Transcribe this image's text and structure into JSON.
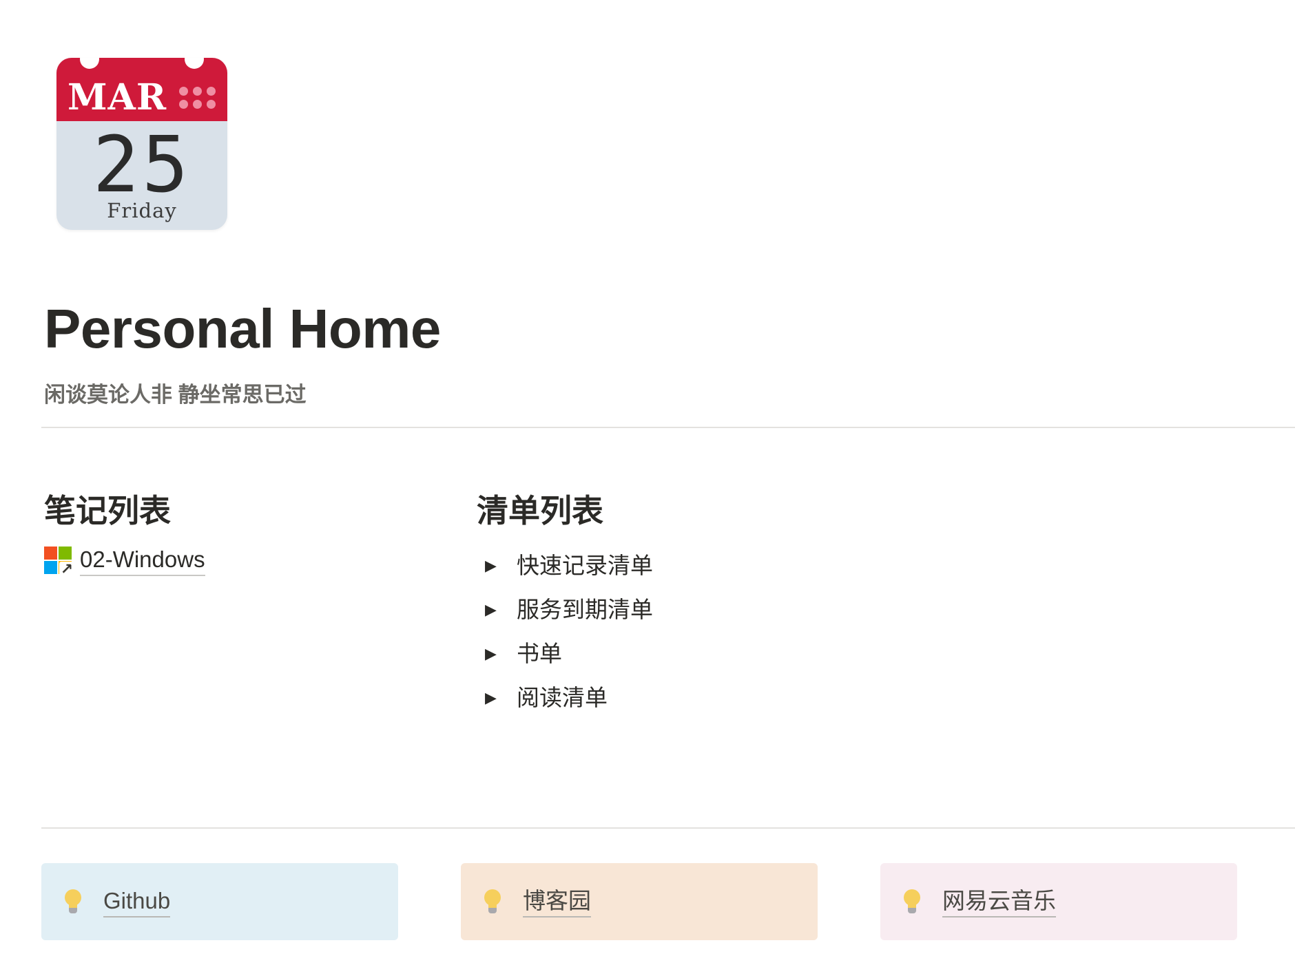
{
  "page_icon": {
    "icon": "calendar-icon",
    "month": "MAR",
    "day": "25",
    "weekday": "Friday",
    "colors": {
      "header": "#cf1a3a",
      "body": "#d9e1e9",
      "dots": "#ef8fa3"
    }
  },
  "page": {
    "title": "Personal Home",
    "subtitle": "闲谈莫论人非 静坐常思已过"
  },
  "notes_section": {
    "heading": "笔记列表",
    "links": [
      {
        "label": "02-Windows",
        "icon": "windows-logo-link-icon"
      }
    ]
  },
  "lists_section": {
    "heading": "清单列表",
    "toggles": [
      {
        "label": "快速记录清单",
        "icon": "toggle-arrow-icon"
      },
      {
        "label": "服务到期清单",
        "icon": "toggle-arrow-icon"
      },
      {
        "label": "书单",
        "icon": "toggle-arrow-icon"
      },
      {
        "label": "阅读清单",
        "icon": "toggle-arrow-icon"
      }
    ],
    "arrow_glyph": "▶"
  },
  "callouts": [
    {
      "label": "Github",
      "icon": "lightbulb-icon",
      "background": "#e1eff5"
    },
    {
      "label": "博客园",
      "icon": "lightbulb-icon",
      "background": "#f8e6d6"
    },
    {
      "label": "网易云音乐",
      "icon": "lightbulb-icon",
      "background": "#f8ecf1"
    }
  ],
  "colors": {
    "text": "#2b2a27",
    "muted_text": "#6b6a66",
    "divider": "#e3e2df",
    "windows_logo": [
      "#f25022",
      "#7fba00",
      "#00a4ef",
      "#ffb900"
    ]
  }
}
